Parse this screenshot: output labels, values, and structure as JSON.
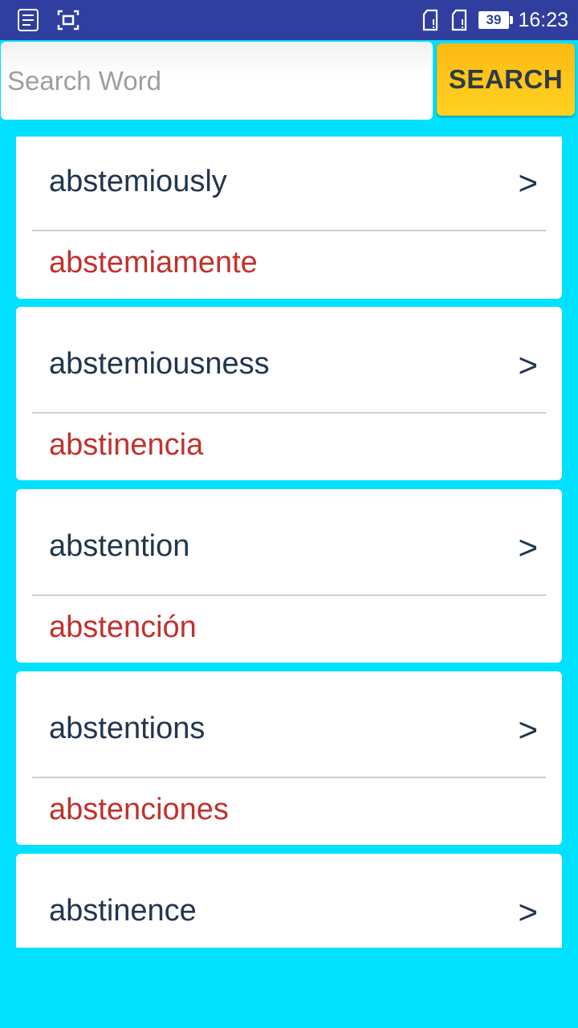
{
  "status_bar": {
    "time": "16:23",
    "battery_level": "39",
    "icons": [
      "notes-app-icon",
      "screenshot-icon",
      "sim-card-icon",
      "sim-card-icon",
      "battery-icon"
    ]
  },
  "search": {
    "placeholder": "Search Word",
    "value": "",
    "button_label": "SEARCH"
  },
  "results": [
    {
      "word": "abstemiously",
      "translation": "abstemiamente",
      "chevron": ">"
    },
    {
      "word": "abstemiousness",
      "translation": "abstinencia",
      "chevron": ">"
    },
    {
      "word": "abstention",
      "translation": "abstención",
      "chevron": ">"
    },
    {
      "word": "abstentions",
      "translation": "abstenciones",
      "chevron": ">"
    },
    {
      "word": "abstinence",
      "translation": "",
      "chevron": ">"
    }
  ],
  "colors": {
    "status_bar": "#303f9f",
    "background": "#00e0ff",
    "search_button": "#ffc61a",
    "word_text": "#22364d",
    "translation_text": "#c0322d"
  }
}
